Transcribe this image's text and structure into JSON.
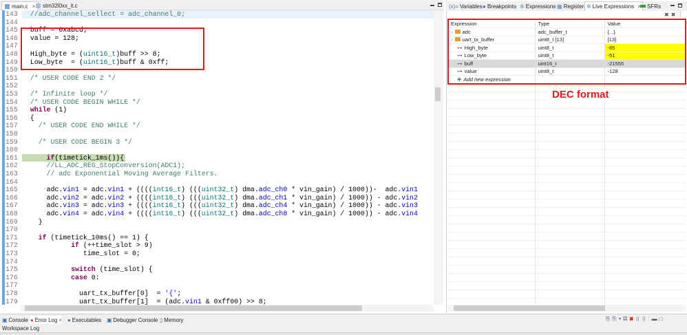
{
  "editor": {
    "tabs": [
      {
        "label": "main.c",
        "active": true,
        "close": "×"
      },
      {
        "label": "stm32l0xx_it.c",
        "active": false
      }
    ],
    "lines": [
      {
        "n": "143",
        "cls": "cur",
        "seg": [
          [
            "c",
            "  //adc_channel_sellect = adc_channel_0;"
          ]
        ]
      },
      {
        "n": "144",
        "seg": []
      },
      {
        "n": "145",
        "seg": [
          [
            "n",
            "  buff = 0xabcd;"
          ]
        ]
      },
      {
        "n": "146",
        "seg": [
          [
            "n",
            "  value = 128;"
          ]
        ]
      },
      {
        "n": "147",
        "seg": []
      },
      {
        "n": "148",
        "seg": [
          [
            "n",
            "  High_byte = ("
          ],
          [
            "t",
            "uint16_t"
          ],
          [
            "n",
            ")buff >> 8;"
          ]
        ]
      },
      {
        "n": "149",
        "seg": [
          [
            "n",
            "  Low_byte  = ("
          ],
          [
            "t",
            "uint16_t"
          ],
          [
            "n",
            ")buff & 0xff;"
          ]
        ]
      },
      {
        "n": "150",
        "seg": []
      },
      {
        "n": "151",
        "seg": [
          [
            "c",
            "  /* USER CODE END 2 */"
          ]
        ]
      },
      {
        "n": "152",
        "seg": []
      },
      {
        "n": "153",
        "seg": [
          [
            "c",
            "  /* Infinite loop */"
          ]
        ]
      },
      {
        "n": "154",
        "seg": [
          [
            "c",
            "  /* USER CODE BEGIN WHILE */"
          ]
        ]
      },
      {
        "n": "155",
        "seg": [
          [
            "k",
            "  while"
          ],
          [
            "n",
            " (1)"
          ]
        ]
      },
      {
        "n": "156",
        "seg": [
          [
            "n",
            "  {"
          ]
        ]
      },
      {
        "n": "157",
        "seg": [
          [
            "c",
            "    /* USER CODE END WHILE */"
          ]
        ]
      },
      {
        "n": "158",
        "seg": []
      },
      {
        "n": "159",
        "seg": [
          [
            "c",
            "    /* USER CODE BEGIN 3 */"
          ]
        ]
      },
      {
        "n": "160",
        "seg": []
      },
      {
        "n": "161",
        "cls": "bp",
        "seg": [
          [
            "k",
            "      if"
          ],
          [
            "n",
            "(timetick_1ms()){"
          ]
        ]
      },
      {
        "n": "162",
        "seg": [
          [
            "c",
            "      //LL_ADC_REG_StopConversion(ADC1);"
          ]
        ]
      },
      {
        "n": "163",
        "seg": [
          [
            "c",
            "      // adc Exponential Moving Average Filters."
          ]
        ]
      },
      {
        "n": "164",
        "seg": []
      },
      {
        "n": "165",
        "seg": [
          [
            "n",
            "      adc."
          ],
          [
            "f",
            "vin1"
          ],
          [
            "n",
            " = adc."
          ],
          [
            "f",
            "vin1"
          ],
          [
            "n",
            " + (((("
          ],
          [
            "t",
            "int16_t"
          ],
          [
            "n",
            ") ((("
          ],
          [
            "t",
            "uint32_t"
          ],
          [
            "n",
            ") dma."
          ],
          [
            "f",
            "adc_ch0"
          ],
          [
            "n",
            " * vin_gain) / 1000))-  adc."
          ],
          [
            "f",
            "vin1"
          ]
        ]
      },
      {
        "n": "166",
        "seg": [
          [
            "n",
            "      adc."
          ],
          [
            "f",
            "vin2"
          ],
          [
            "n",
            " = adc."
          ],
          [
            "f",
            "vin2"
          ],
          [
            "n",
            " + (((("
          ],
          [
            "t",
            "int16_t"
          ],
          [
            "n",
            ") ((("
          ],
          [
            "t",
            "uint32_t"
          ],
          [
            "n",
            ") dma."
          ],
          [
            "f",
            "adc_ch1"
          ],
          [
            "n",
            " * vin_gain) / 1000)) - adc."
          ],
          [
            "f",
            "vin2"
          ]
        ]
      },
      {
        "n": "167",
        "seg": [
          [
            "n",
            "      adc."
          ],
          [
            "f",
            "vin3"
          ],
          [
            "n",
            " = adc."
          ],
          [
            "f",
            "vin3"
          ],
          [
            "n",
            " + (((("
          ],
          [
            "t",
            "int16_t"
          ],
          [
            "n",
            ") ((("
          ],
          [
            "t",
            "uint32_t"
          ],
          [
            "n",
            ") dma."
          ],
          [
            "f",
            "adc_ch4"
          ],
          [
            "n",
            " * vin_gain) / 1000)) - adc."
          ],
          [
            "f",
            "vin3"
          ]
        ]
      },
      {
        "n": "168",
        "seg": [
          [
            "n",
            "      adc."
          ],
          [
            "f",
            "vin4"
          ],
          [
            "n",
            " = adc."
          ],
          [
            "f",
            "vin4"
          ],
          [
            "n",
            " + (((("
          ],
          [
            "t",
            "int16_t"
          ],
          [
            "n",
            ") ((("
          ],
          [
            "t",
            "uint32_t"
          ],
          [
            "n",
            ") dma."
          ],
          [
            "f",
            "adc_ch8"
          ],
          [
            "n",
            " * vin_gain) / 1000)) - adc."
          ],
          [
            "f",
            "vin4"
          ]
        ]
      },
      {
        "n": "169",
        "seg": [
          [
            "n",
            "    }"
          ]
        ]
      },
      {
        "n": "170",
        "seg": []
      },
      {
        "n": "171",
        "seg": [
          [
            "k",
            "    if"
          ],
          [
            "n",
            " (timetick_10ms() == 1) {"
          ]
        ]
      },
      {
        "n": "172",
        "seg": [
          [
            "k",
            "            if"
          ],
          [
            "n",
            " (++time_slot > 9)"
          ]
        ]
      },
      {
        "n": "173",
        "seg": [
          [
            "n",
            "               time_slot = 0;"
          ]
        ]
      },
      {
        "n": "174",
        "seg": []
      },
      {
        "n": "175",
        "seg": [
          [
            "k",
            "            switch"
          ],
          [
            "n",
            " (time_slot) {"
          ]
        ]
      },
      {
        "n": "176",
        "seg": [
          [
            "k",
            "            case"
          ],
          [
            "n",
            " 0:"
          ]
        ]
      },
      {
        "n": "177",
        "seg": []
      },
      {
        "n": "178",
        "seg": [
          [
            "n",
            "              uart_tx_buffer[0]  = "
          ],
          [
            "s",
            "'{'"
          ],
          [
            "n",
            ";"
          ]
        ]
      },
      {
        "n": "179",
        "seg": [
          [
            "n",
            "              uart_tx_buffer[1]  = (adc."
          ],
          [
            "f",
            "vin1"
          ],
          [
            "n",
            " & 0xff00) >> 8;"
          ]
        ]
      }
    ]
  },
  "right": {
    "tabs": [
      {
        "label": "Variables",
        "icon": "variables-icon"
      },
      {
        "label": "Breakpoints",
        "icon": "breakpoints-icon"
      },
      {
        "label": "Expressions",
        "icon": "expressions-icon"
      },
      {
        "label": "Registers",
        "icon": "registers-icon"
      },
      {
        "label": "Live Expressions",
        "icon": "live-expressions-icon",
        "active": true,
        "close": "×"
      },
      {
        "label": "SFRs",
        "icon": "sfrs-icon"
      }
    ],
    "columns": [
      "Expression",
      "Type",
      "Value"
    ],
    "rows": [
      {
        "expr": "adc",
        "type": "adc_buffer_t",
        "value": "{...}",
        "expand": "›",
        "icon": "struct-icon"
      },
      {
        "expr": "uart_tx_buffer",
        "type": "uint8_t [13]",
        "value": "[13]",
        "expand": "›",
        "icon": "struct-icon"
      },
      {
        "expr": "High_byte",
        "type": "uint8_t",
        "value": "-85",
        "changed": true,
        "icon": "variable-icon"
      },
      {
        "expr": "Low_byte",
        "type": "uint8_t",
        "value": "-51",
        "changed": true,
        "icon": "variable-icon"
      },
      {
        "expr": "buff",
        "type": "uint16_t",
        "value": "-21555",
        "selected": true,
        "icon": "variable-icon"
      },
      {
        "expr": "value",
        "type": "uint8_t",
        "value": "-128",
        "icon": "variable-icon"
      }
    ],
    "add_label": "Add new expression",
    "annotation": "DEC format",
    "highlight_color": "#ffff00",
    "annotation_color": "#e8141c"
  },
  "bottom": {
    "tabs": [
      {
        "label": "Console"
      },
      {
        "label": "Error Log",
        "active": true,
        "close": "×"
      },
      {
        "label": "Executables"
      },
      {
        "label": "Debugger Console"
      },
      {
        "label": "Memory"
      }
    ],
    "subtitle": "Workspace Log"
  }
}
